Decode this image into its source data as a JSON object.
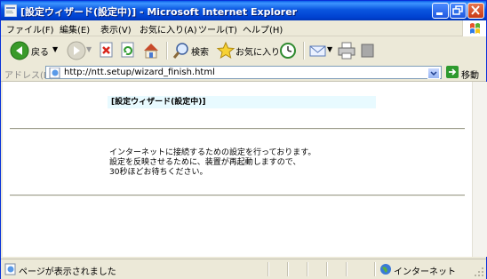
{
  "window": {
    "title": "[設定ウィザード(設定中)] - Microsoft Internet Explorer"
  },
  "menu": {
    "items": [
      "ファイル(F)",
      "編集(E)",
      "表示(V)",
      "お気に入り(A)",
      "ツール(T)",
      "ヘルプ(H)"
    ]
  },
  "toolbar": {
    "back_label": "戻る",
    "search_label": "検索",
    "favorites_label": "お気に入り"
  },
  "address": {
    "label": "アドレス(D)",
    "url": "http://ntt.setup/wizard_finish.html",
    "go_label": "移動"
  },
  "page": {
    "heading": "[設定ウィザード(設定中)]",
    "message_lines": [
      "インターネットに接続するための設定を行っております。",
      "設定を反映させるために、装置が再起動しますので、",
      "30秒ほどお待ちください。"
    ]
  },
  "status": {
    "text": "ページが表示されました",
    "zone": "インターネット"
  },
  "colors": {
    "titlebar": "#0A56E0",
    "heading_bg": "#E8FAFF",
    "go_green": "#2E9A2E"
  }
}
